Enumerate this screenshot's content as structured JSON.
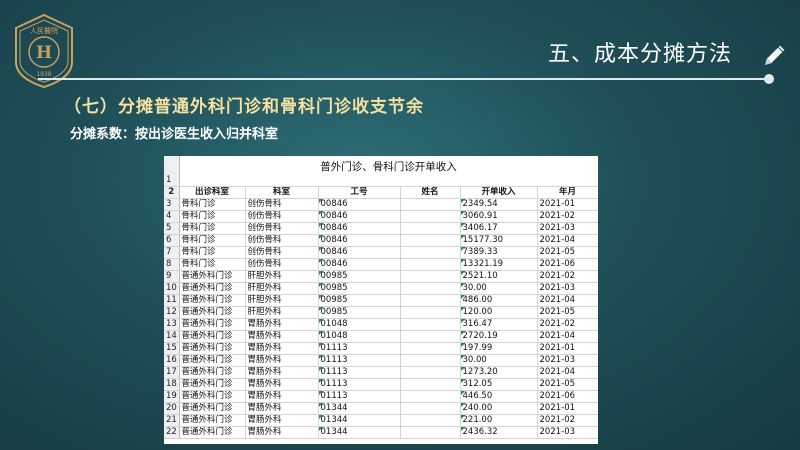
{
  "logo": {
    "text": "人民醫院",
    "letter": "H",
    "year": "1938"
  },
  "header": {
    "title": "五、成本分摊方法"
  },
  "section": {
    "title": "（七）分摊普通外科门诊和骨科门诊收支节余",
    "subtitle": "分摊系数：按出诊医生收入归并科室"
  },
  "sheet": {
    "title": "普外门诊、骨科门诊开单收入",
    "columns": [
      "出诊科室",
      "科室",
      "工号",
      "姓名",
      "开单收入",
      "年月"
    ],
    "rows": [
      {
        "rn": "3",
        "dept": "骨科门诊",
        "ward": "创伤骨科",
        "id": "00846",
        "name": "",
        "income": "2349.54",
        "month": "2021-01"
      },
      {
        "rn": "4",
        "dept": "骨科门诊",
        "ward": "创伤骨科",
        "id": "00846",
        "name": "",
        "income": "3060.91",
        "month": "2021-02"
      },
      {
        "rn": "5",
        "dept": "骨科门诊",
        "ward": "创伤骨科",
        "id": "00846",
        "name": "",
        "income": "3406.17",
        "month": "2021-03"
      },
      {
        "rn": "6",
        "dept": "骨科门诊",
        "ward": "创伤骨科",
        "id": "00846",
        "name": "",
        "income": "15177.30",
        "month": "2021-04"
      },
      {
        "rn": "7",
        "dept": "骨科门诊",
        "ward": "创伤骨科",
        "id": "00846",
        "name": "",
        "income": "7389.33",
        "month": "2021-05"
      },
      {
        "rn": "8",
        "dept": "骨科门诊",
        "ward": "创伤骨科",
        "id": "00846",
        "name": "",
        "income": "13321.19",
        "month": "2021-06"
      },
      {
        "rn": "9",
        "dept": "普通外科门诊",
        "ward": "肝胆外科",
        "id": "00985",
        "name": "",
        "income": "2521.10",
        "month": "2021-02"
      },
      {
        "rn": "10",
        "dept": "普通外科门诊",
        "ward": "肝胆外科",
        "id": "00985",
        "name": "",
        "income": "30.00",
        "month": "2021-03"
      },
      {
        "rn": "11",
        "dept": "普通外科门诊",
        "ward": "肝胆外科",
        "id": "00985",
        "name": "",
        "income": "486.00",
        "month": "2021-04"
      },
      {
        "rn": "12",
        "dept": "普通外科门诊",
        "ward": "肝胆外科",
        "id": "00985",
        "name": "",
        "income": "120.00",
        "month": "2021-05"
      },
      {
        "rn": "13",
        "dept": "普通外科门诊",
        "ward": "胃肠外科",
        "id": "01048",
        "name": "",
        "income": "316.47",
        "month": "2021-02"
      },
      {
        "rn": "14",
        "dept": "普通外科门诊",
        "ward": "胃肠外科",
        "id": "01048",
        "name": "",
        "income": "2720.19",
        "month": "2021-04"
      },
      {
        "rn": "15",
        "dept": "普通外科门诊",
        "ward": "胃肠外科",
        "id": "01113",
        "name": "",
        "income": "197.99",
        "month": "2021-01"
      },
      {
        "rn": "16",
        "dept": "普通外科门诊",
        "ward": "胃肠外科",
        "id": "01113",
        "name": "",
        "income": "30.00",
        "month": "2021-03"
      },
      {
        "rn": "17",
        "dept": "普通外科门诊",
        "ward": "胃肠外科",
        "id": "01113",
        "name": "",
        "income": "1273.20",
        "month": "2021-04"
      },
      {
        "rn": "18",
        "dept": "普通外科门诊",
        "ward": "胃肠外科",
        "id": "01113",
        "name": "",
        "income": "312.05",
        "month": "2021-05"
      },
      {
        "rn": "19",
        "dept": "普通外科门诊",
        "ward": "胃肠外科",
        "id": "01113",
        "name": "",
        "income": "446.50",
        "month": "2021-06"
      },
      {
        "rn": "20",
        "dept": "普通外科门诊",
        "ward": "胃肠外科",
        "id": "01344",
        "name": "",
        "income": "240.00",
        "month": "2021-01"
      },
      {
        "rn": "21",
        "dept": "普通外科门诊",
        "ward": "胃肠外科",
        "id": "01344",
        "name": "",
        "income": "221.00",
        "month": "2021-02"
      },
      {
        "rn": "22",
        "dept": "普通外科门诊",
        "ward": "胃肠外科",
        "id": "01344",
        "name": "",
        "income": "2436.32",
        "month": "2021-03"
      }
    ]
  },
  "colors": {
    "background": "#1f4f58",
    "accent_title": "#f4e0a0",
    "logo_gold": "#c8a060"
  }
}
